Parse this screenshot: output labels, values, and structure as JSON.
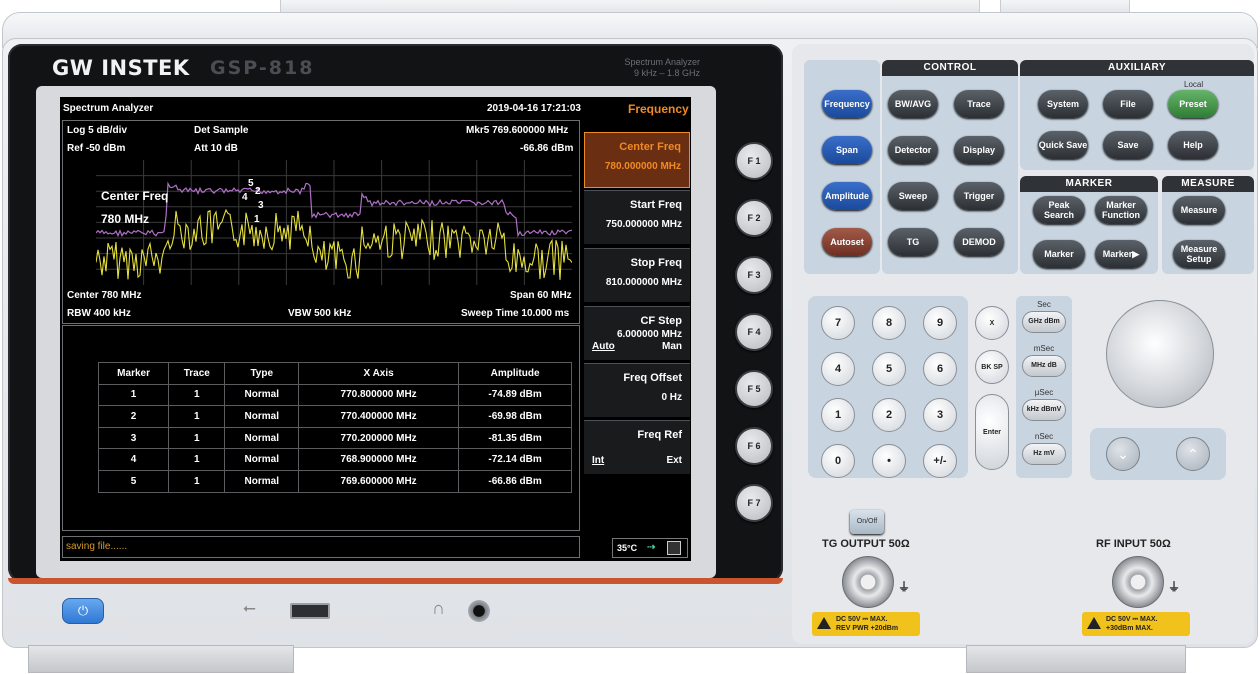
{
  "device": {
    "brand": "GW INSTEK",
    "model": "GSP-818",
    "subtitle_line1": "Spectrum Analyzer",
    "subtitle_line2": "9 kHz – 1.8 GHz"
  },
  "screen": {
    "mode_title": "Spectrum Analyzer",
    "datetime": "2019-04-16 17:21:03",
    "menu_title": "Frequency",
    "scale": "Log 5 dB/div",
    "detector": "Det Sample",
    "marker_readout": "Mkr5  769.600000 MHz",
    "ref_level": "Ref -50 dBm",
    "attenuation": "Att 10 dB",
    "marker_amplitude": "-66.86 dBm",
    "overlay_label": "Center Freq",
    "overlay_value": "780 MHz",
    "center": "Center 780 MHz",
    "span": "Span 60 MHz",
    "rbw": "RBW 400 kHz",
    "vbw": "VBW 500 kHz",
    "sweep_time": "Sweep Time 10.000 ms",
    "status": "saving file......",
    "temperature": "35°C",
    "marker_numbers": [
      "5",
      "2",
      "4",
      "3",
      "1"
    ],
    "softkeys": [
      {
        "title": "Center Freq",
        "value": "780.000000 MHz"
      },
      {
        "title": "Start Freq",
        "value": "750.000000 MHz"
      },
      {
        "title": "Stop Freq",
        "value": "810.000000 MHz"
      },
      {
        "title": "CF Step",
        "value": "6.000000 MHz",
        "opt_left": "Auto",
        "opt_right": "Man"
      },
      {
        "title": "Freq Offset",
        "value": "0 Hz"
      },
      {
        "title": "Freq Ref",
        "opt_left": "Int",
        "opt_right": "Ext"
      }
    ],
    "marker_table": {
      "headers": [
        "Marker",
        "Trace",
        "Type",
        "X Axis",
        "Amplitude"
      ],
      "rows": [
        [
          "1",
          "1",
          "Normal",
          "770.800000 MHz",
          "-74.89 dBm"
        ],
        [
          "2",
          "1",
          "Normal",
          "770.400000 MHz",
          "-69.98 dBm"
        ],
        [
          "3",
          "1",
          "Normal",
          "770.200000 MHz",
          "-81.35 dBm"
        ],
        [
          "4",
          "1",
          "Normal",
          "768.900000 MHz",
          "-72.14 dBm"
        ],
        [
          "5",
          "1",
          "Normal",
          "769.600000 MHz",
          "-66.86 dBm"
        ]
      ]
    }
  },
  "fkeys": [
    "F 1",
    "F 2",
    "F 3",
    "F 4",
    "F 5",
    "F 6",
    "F 7"
  ],
  "left_keys": [
    "Frequency",
    "Span",
    "Amplitude",
    "Autoset"
  ],
  "control": {
    "heading": "CONTROL",
    "keys": [
      "BW/AVG",
      "Trace",
      "Detector",
      "Display",
      "Sweep",
      "Trigger",
      "TG",
      "DEMOD"
    ]
  },
  "auxiliary": {
    "heading": "AUXILIARY",
    "local_label": "Local",
    "keys": [
      "System",
      "File",
      "Preset",
      "Quick Save",
      "Save",
      "Help"
    ]
  },
  "marker_group": {
    "heading": "MARKER",
    "keys": [
      "Peak Search",
      "Marker Function",
      "Marker",
      "Marker▶"
    ]
  },
  "measure_group": {
    "heading": "MEASURE",
    "keys": [
      "Measure",
      "Measure Setup"
    ]
  },
  "keypad": [
    "7",
    "8",
    "9",
    "4",
    "5",
    "6",
    "1",
    "2",
    "3",
    "0",
    "•",
    "+/-"
  ],
  "keypad_side": {
    "cancel": "X",
    "backspace": "BK SP",
    "enter": "Enter"
  },
  "unit_keys": [
    {
      "top": "Sec",
      "label": "GHz dBm"
    },
    {
      "top": "mSec",
      "label": "MHz dB"
    },
    {
      "top": "µSec",
      "label": "kHz dBmV"
    },
    {
      "top": "nSec",
      "label": "Hz mV"
    }
  ],
  "tg": {
    "onoff": "On/Off",
    "label": "TG  OUTPUT  50Ω",
    "warn1": "DC 50V  ⎓  MAX.",
    "warn2": "REV  PWR  +20dBm"
  },
  "rf": {
    "label": "RF  INPUT  50Ω",
    "warn1": "DC 50V  ⎓  MAX.",
    "warn2": "+30dBm  MAX."
  },
  "colors": {
    "accent": "#f08a24",
    "trace_yellow": "#e5e03a",
    "trace_purple": "#b070c8",
    "panel_blue": "#c8d4e0"
  }
}
